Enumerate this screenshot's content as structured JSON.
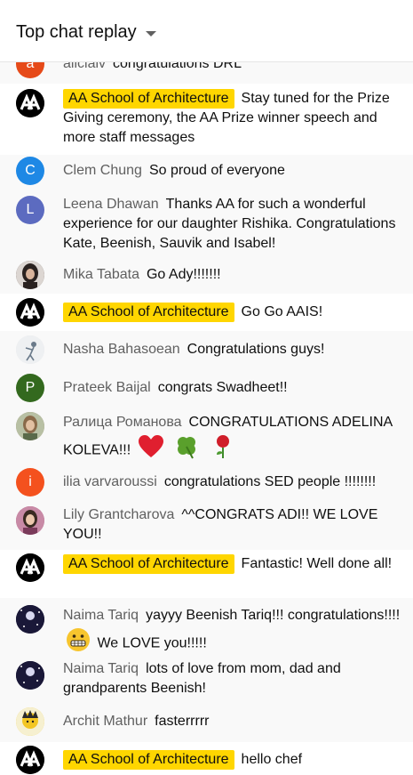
{
  "header": {
    "title": "Top chat replay"
  },
  "messages": [
    {
      "author": "aliciaiv",
      "text": "congratulations DRL",
      "owner": false,
      "avatar": {
        "type": "letter",
        "letter": "a",
        "color": "#e64a19"
      }
    },
    {
      "author": "AA School of Architecture",
      "text": "Stay tuned for the Prize Giving ceremony, the AA Prize winner speech and more staff messages",
      "owner": true,
      "avatar": {
        "type": "aa-logo"
      }
    },
    {
      "author": "Clem Chung",
      "text": "So proud of everyone",
      "owner": false,
      "avatar": {
        "type": "letter",
        "letter": "C",
        "color": "#1e88e5"
      }
    },
    {
      "author": "Leena Dhawan",
      "text": "Thanks AA for such a wonderful experience for our daughter Rishika. Congratulations Kate, Beenish, Sauvik and Isabel!",
      "owner": false,
      "avatar": {
        "type": "letter",
        "letter": "L",
        "color": "#5c6bc0"
      }
    },
    {
      "author": "Mika Tabata",
      "text": "Go Ady!!!!!!!",
      "owner": false,
      "avatar": {
        "type": "photo",
        "icon": "woman-portrait-icon",
        "color": "#4a3d38"
      }
    },
    {
      "author": "AA School of Architecture",
      "text": "Go Go AAIS!",
      "owner": true,
      "avatar": {
        "type": "aa-logo"
      }
    },
    {
      "author": "Nasha Bahasoean",
      "text": "Congratulations guys!",
      "owner": false,
      "avatar": {
        "type": "photo",
        "icon": "sketch-figure-icon",
        "color": "#e6e6e6"
      }
    },
    {
      "author": "Prateek Baijal",
      "text": "congrats Swadheet!!",
      "owner": false,
      "avatar": {
        "type": "letter",
        "letter": "P",
        "color": "#33691e"
      }
    },
    {
      "author": "Ралица Романова",
      "text": "CONGRATULATIONS ADELINA KOLEVA!!!",
      "owner": false,
      "avatar": {
        "type": "photo",
        "icon": "woman-portrait-icon",
        "color": "#9c8a6e"
      },
      "emojis": [
        "heart-emoji",
        "clover-emoji",
        "rose-emoji"
      ]
    },
    {
      "author": "ilia varvaroussi",
      "text": "congratulations SED people !!!!!!!!",
      "owner": false,
      "avatar": {
        "type": "letter",
        "letter": "i",
        "color": "#f4511e"
      }
    },
    {
      "author": "Lily Grantcharova",
      "text": "^^CONGRATS ADI!! WE LOVE YOU!!",
      "owner": false,
      "avatar": {
        "type": "photo",
        "icon": "woman-portrait-icon",
        "color": "#b46a8a"
      }
    },
    {
      "author": "AA School of Architecture",
      "text": "Fantastic! Well done all!",
      "owner": true,
      "avatar": {
        "type": "aa-logo"
      }
    },
    {
      "author": "Naima Tariq",
      "text": "yayyy Beenish Tariq!!! congratulations!!!!",
      "text2": "We LOVE you!!!!!",
      "owner": false,
      "avatar": {
        "type": "photo",
        "icon": "night-sky-icon",
        "color": "#1a1838"
      },
      "emojis": [
        "grimacing-emoji"
      ]
    },
    {
      "author": "Naima Tariq",
      "text": "lots of love from mom, dad and grandparents Beenish!",
      "owner": false,
      "avatar": {
        "type": "photo",
        "icon": "night-sky-icon",
        "color": "#1a1838"
      }
    },
    {
      "author": "Archit Mathur",
      "text": "fasterrrrr",
      "owner": false,
      "avatar": {
        "type": "photo",
        "icon": "cartoon-avatar-icon",
        "color": "#f3c623"
      }
    },
    {
      "author": "AA School of Architecture",
      "text": "hello chef",
      "owner": true,
      "avatar": {
        "type": "aa-logo"
      }
    }
  ]
}
